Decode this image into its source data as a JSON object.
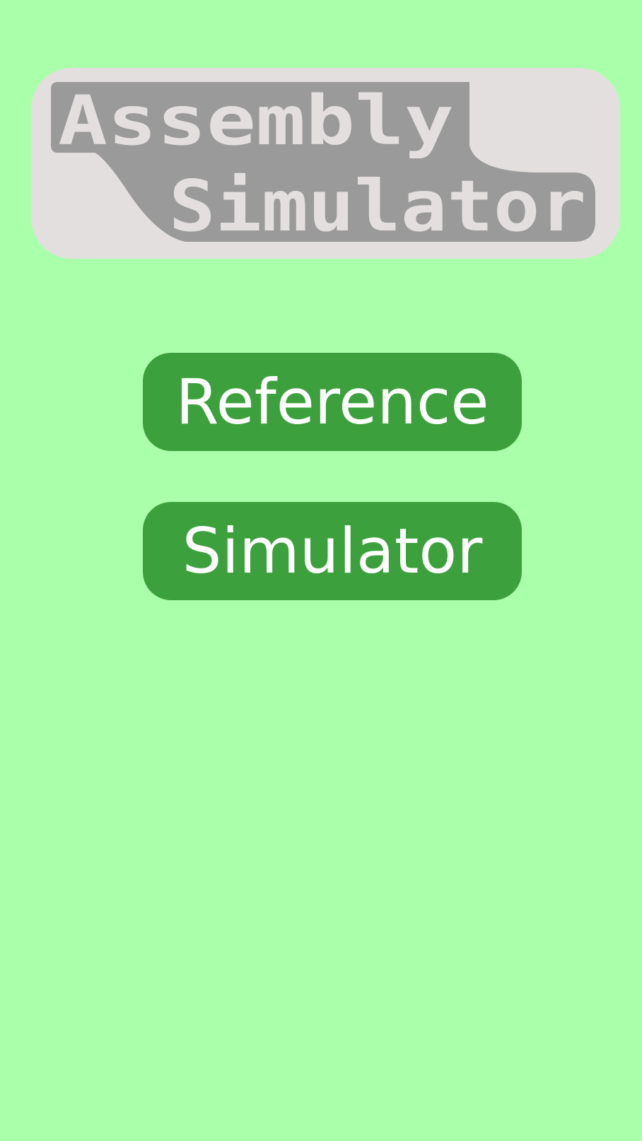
{
  "theme": {
    "background": "#aaffaa",
    "logo_card": "#e4dfdf",
    "logo_shape": "#9a9a9a",
    "button_fill": "#3ca13c",
    "button_text": "#ffffff"
  },
  "logo": {
    "line1": "Assembly",
    "line2": "Simulator"
  },
  "menu": {
    "reference_label": "Reference",
    "simulator_label": "Simulator"
  }
}
